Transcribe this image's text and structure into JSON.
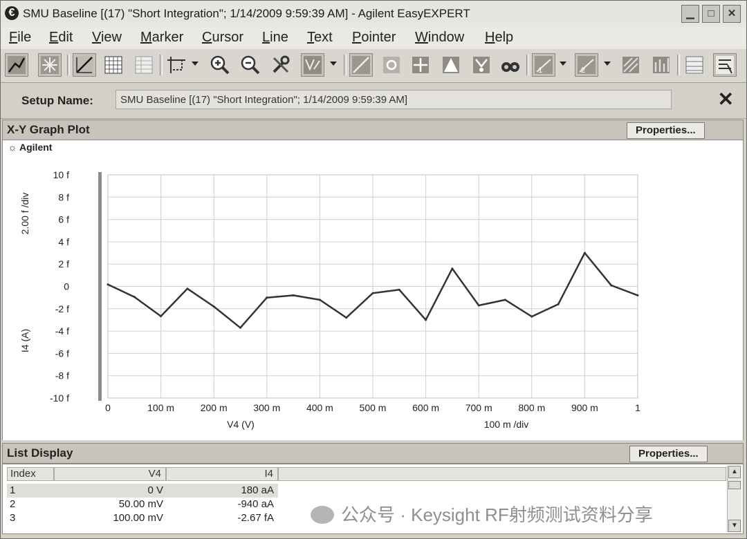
{
  "window": {
    "title": "SMU Baseline [(17) \"Short Integration\"; 1/14/2009 9:59:39 AM] - Agilent EasyEXPERT",
    "icon": "e-logo-icon",
    "controls": [
      "minimize-icon",
      "maximize-icon",
      "close-icon"
    ]
  },
  "menu": [
    {
      "key": "F",
      "rest": "ile"
    },
    {
      "key": "E",
      "rest": "dit"
    },
    {
      "key": "V",
      "rest": "iew"
    },
    {
      "key": "M",
      "rest": "arker"
    },
    {
      "key": "C",
      "rest": "ursor"
    },
    {
      "key": "L",
      "rest": "ine"
    },
    {
      "key": "T",
      "rest": "ext"
    },
    {
      "key": "P",
      "rest": "ointer"
    },
    {
      "key": "W",
      "rest": "indow"
    },
    {
      "key": "H",
      "rest": "elp"
    }
  ],
  "toolbar": {
    "icons": [
      "graph-plot-icon",
      "autoscale-icon",
      "linear-plot-icon",
      "grid-icon",
      "table-icon",
      "zoom-box-icon",
      "zoom-in-icon",
      "zoom-out-icon",
      "tools-icon",
      "scale-icon",
      "line-fit-icon",
      "marker-icon",
      "cursor-icon",
      "pointer-icon",
      "marker-to-point-icon",
      "search-binoculars-icon",
      "y1-axis-icon",
      "y2-axis-icon",
      "overlay-icon",
      "overlay2-icon",
      "list-icon",
      "text-icon"
    ]
  },
  "setup": {
    "label": "Setup Name:",
    "value": "SMU Baseline [(17) \"Short Integration\"; 1/14/2009 9:59:39 AM]",
    "close_icon": "close-icon"
  },
  "graph_panel": {
    "title": "X-Y Graph Plot",
    "properties_label": "Properties...",
    "brand": "Agilent",
    "brand_icon": "spark-icon"
  },
  "chart_data": {
    "type": "line",
    "x": [
      0,
      0.05,
      0.1,
      0.15,
      0.2,
      0.25,
      0.3,
      0.35,
      0.4,
      0.45,
      0.5,
      0.55,
      0.6,
      0.65,
      0.7,
      0.75,
      0.8,
      0.85,
      0.9,
      0.95,
      1.0
    ],
    "y": [
      0.18,
      -0.94,
      -2.67,
      -0.2,
      -1.8,
      -3.7,
      -1.0,
      -0.8,
      -1.2,
      -2.8,
      -0.6,
      -0.3,
      -3.0,
      1.6,
      -1.7,
      -1.2,
      -2.7,
      -1.6,
      3.0,
      0.1,
      -0.8
    ],
    "xlim": [
      0,
      1
    ],
    "ylim": [
      -10,
      10
    ],
    "x_ticks": [
      "0",
      "100 m",
      "200 m",
      "300 m",
      "400 m",
      "500 m",
      "600 m",
      "700 m",
      "800 m",
      "900 m",
      "1"
    ],
    "y_ticks": [
      "10 f",
      "8 f",
      "6 f",
      "4 f",
      "2 f",
      "0",
      "-2 f",
      "-4 f",
      "-6 f",
      "-8 f",
      "-10 f"
    ],
    "xlabel": "V4 (V)",
    "x_div_label": "100 m /div",
    "ylabel": "I4 (A)",
    "y_div_label": "2.00 f /div",
    "grid": true,
    "line_color": "#333333",
    "grid_color": "#d0d0d0"
  },
  "list_panel": {
    "title": "List Display",
    "properties_label": "Properties...",
    "headers": [
      "Index",
      "V4",
      "I4"
    ],
    "rows": [
      {
        "index": "1",
        "v4": "0 V",
        "i4": "180 aA"
      },
      {
        "index": "2",
        "v4": "50.00 mV",
        "i4": "-940 aA"
      },
      {
        "index": "3",
        "v4": "100.00 mV",
        "i4": "-2.67 fA"
      }
    ]
  },
  "watermark": {
    "text": "公众号 · Keysight RF射频测试资料分享",
    "icon": "wechat-icon"
  }
}
